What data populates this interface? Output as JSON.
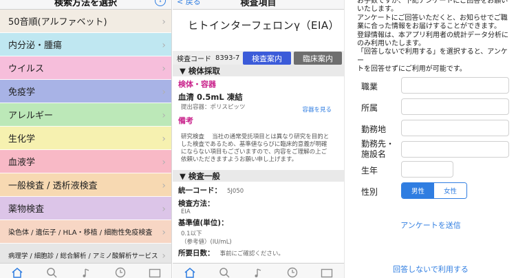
{
  "panel1": {
    "nav_title": "検索方法を選択",
    "categories": [
      {
        "label": "50音順(アルファベット)",
        "color": "#f2ece3"
      },
      {
        "label": "内分泌・腫瘍",
        "color": "#bfe7f1"
      },
      {
        "label": "ウイルス",
        "color": "#f6bedb"
      },
      {
        "label": "免疫学",
        "color": "#a8b3e6"
      },
      {
        "label": "アレルギー",
        "color": "#bce8b8"
      },
      {
        "label": "生化学",
        "color": "#f6f1b0"
      },
      {
        "label": "血液学",
        "color": "#f8b9c6"
      },
      {
        "label": "一般検査 / 透析液検査",
        "color": "#f7d9b2"
      },
      {
        "label": "薬物検査",
        "color": "#dcc5e8"
      },
      {
        "label": "染色体 / 遺伝子 / HLA・移植 / 細胞性免疫検査",
        "color": "#f7d6c4"
      },
      {
        "label": "病理学 / 細胞診 / 総合解析 / アミノ酸解析サービス",
        "color": "#e6e6e6"
      }
    ]
  },
  "panel2": {
    "nav_back": "< 戻る",
    "nav_title": "検査項目",
    "test_title": "ヒトインターフェロンγ（EIA）",
    "code_label": "検査コード",
    "code_value": "8393-7",
    "btn_test_info": "検査案内",
    "btn_clinical_info": "臨床案内",
    "section_sample": "▼ 検体採取",
    "sample_label": "検体・容器",
    "sample_value": "血清  0.5mL 凍結",
    "container_text": "提出容器：ポリスピッツ",
    "container_link": "容器を見る",
    "remarks_label": "備考",
    "remarks_text": "研究検査　 当社の通常受託項目とは異なり研究を目的とした検査であるため、基準値ならびに臨床的意義が明確にならない項目もございますので、内容をご理解の上ご依頼いただきますようお願い申し上げます。",
    "section_general": "▼ 検査一般",
    "unified_code_label": "統一コード：",
    "unified_code_value": "5J050",
    "method_label": "検査方法：",
    "method_value": "EIA",
    "ref_label": "基準値(単位)：",
    "ref_value1": "0.1以下",
    "ref_value2": "（参考値）(IU/mL)",
    "days_label": "所要日数：",
    "days_value": "事前にご確認ください。"
  },
  "panel3": {
    "intro_lines": [
      "お手数ですが、下記アンケートにご回答をお願い",
      "いたします。",
      "アンケートにご回答いただくと、お知らせでご職",
      "業に合った情報をお届けすることができます。",
      "登録情報は、本アプリ利用者の統計データ分析に",
      "のみ利用いたします。",
      "「回答しないで利用する」を選択すると、アンケー",
      "トを回答せずにご利用が可能です。"
    ],
    "field_occupation": "職業",
    "field_affiliation": "所属",
    "field_location": "勤務地",
    "field_workplace_1": "勤務先・",
    "field_workplace_2": "施設名",
    "field_birth_year": "生年",
    "field_gender": "性別",
    "gender_male": "男性",
    "gender_female": "女性",
    "submit_label": "アンケートを送信",
    "skip_label": "回答しないで利用する"
  },
  "colors": {
    "accent": "#2f7de1",
    "magenta": "#c8208a",
    "button_blue": "#3b5bd9",
    "button_gray": "#6e6e6e"
  }
}
